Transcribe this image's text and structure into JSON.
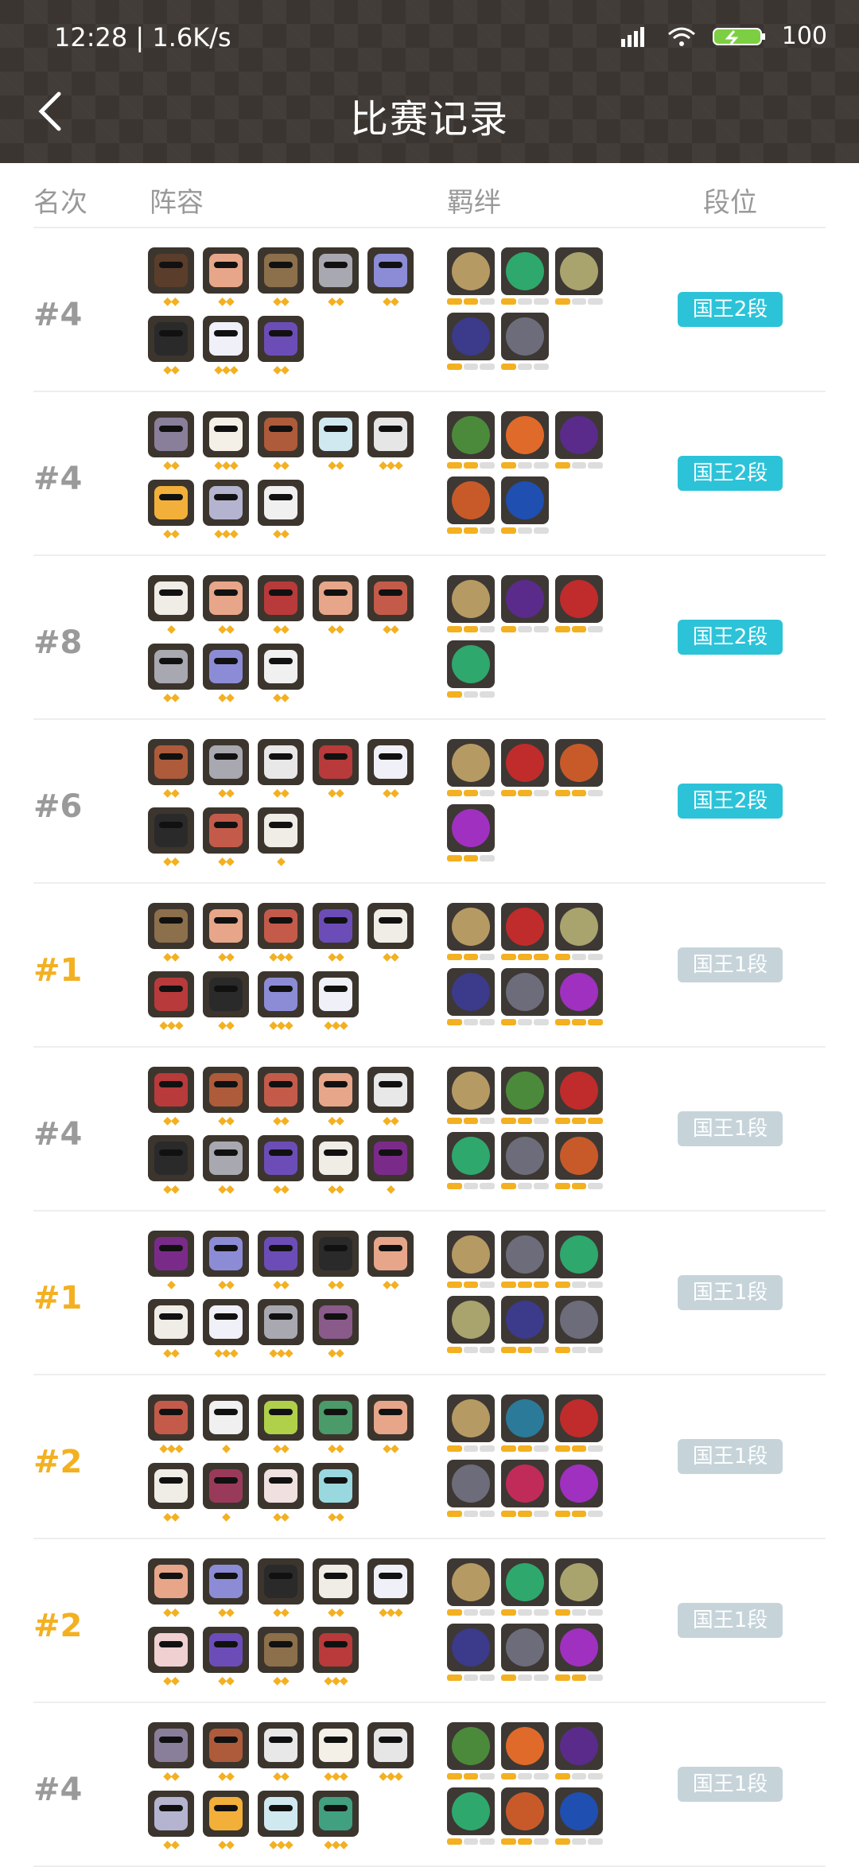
{
  "status": {
    "time": "12:28 | 1.6K/s",
    "battery": "100"
  },
  "title": "比赛记录",
  "columns": {
    "rank": "名次",
    "lineup": "阵容",
    "traits": "羁绊",
    "tier": "段位"
  },
  "rows": [
    {
      "rank": "#4",
      "win": false,
      "tier": "国王2段",
      "tierLevel": "k2",
      "heroes": [
        [
          "#5a3d2a",
          "2"
        ],
        [
          "#e7a68a",
          "2"
        ],
        [
          "#8c6f4b",
          "2"
        ],
        [
          "#a8a8b0",
          "2"
        ],
        [
          "#8c8cd6",
          "2"
        ],
        [
          "#2a2a2a",
          "2"
        ],
        [
          "#f0f0f8",
          "3"
        ],
        [
          "#6c4db8",
          "2"
        ]
      ],
      "traits": [
        [
          "#b69a63",
          "x",
          2
        ],
        [
          "#2ea86c",
          "p",
          1
        ],
        [
          "#a9a36e",
          "c",
          1
        ],
        [
          "#3b3a8b",
          "f",
          1
        ],
        [
          "#6c6c7a",
          "s",
          1
        ]
      ]
    },
    {
      "rank": "#4",
      "win": false,
      "tier": "国王2段",
      "tierLevel": "k2",
      "heroes": [
        [
          "#8a7f9a",
          "2"
        ],
        [
          "#f4f0e8",
          "3"
        ],
        [
          "#ad5b3a",
          "2"
        ],
        [
          "#d0e9f0",
          "2"
        ],
        [
          "#e6e6e6",
          "3"
        ],
        [
          "#f2b03a",
          "2"
        ],
        [
          "#b4b4d0",
          "3"
        ],
        [
          "#f0f0f0",
          "2"
        ]
      ],
      "traits": [
        [
          "#4b8a3a",
          "b",
          2
        ],
        [
          "#e06a2a",
          "l",
          1
        ],
        [
          "#5a2b8a",
          "h",
          1
        ],
        [
          "#c85a2a",
          "d",
          2
        ],
        [
          "#1f4fb0",
          "w",
          1
        ]
      ]
    },
    {
      "rank": "#8",
      "win": false,
      "tier": "国王2段",
      "tierLevel": "k2",
      "heroes": [
        [
          "#f0ece6",
          "1"
        ],
        [
          "#e7a68a",
          "2"
        ],
        [
          "#b83a3a",
          "2"
        ],
        [
          "#e7a68a",
          "2"
        ],
        [
          "#c45b4a",
          "2"
        ],
        [
          "#a8a8b0",
          "2"
        ],
        [
          "#8c8cd6",
          "2"
        ],
        [
          "#f0f0f0",
          "2"
        ]
      ],
      "traits": [
        [
          "#b69a63",
          "x",
          2
        ],
        [
          "#5a2b8a",
          "h",
          1
        ],
        [
          "#c02b2b",
          "a",
          2
        ],
        [
          "#2ea86c",
          "p",
          1
        ]
      ]
    },
    {
      "rank": "#6",
      "win": false,
      "tier": "国王2段",
      "tierLevel": "k2",
      "heroes": [
        [
          "#ad5b3a",
          "2"
        ],
        [
          "#a8a8b0",
          "2"
        ],
        [
          "#e8e8e8",
          "2"
        ],
        [
          "#b83a3a",
          "2"
        ],
        [
          "#f0f0f8",
          "2"
        ],
        [
          "#2a2a2a",
          "2"
        ],
        [
          "#c45b4a",
          "2"
        ],
        [
          "#f0ece6",
          "1"
        ]
      ],
      "traits": [
        [
          "#b69a63",
          "x",
          2
        ],
        [
          "#c02b2b",
          "a",
          2
        ],
        [
          "#c85a2a",
          "d",
          2
        ],
        [
          "#a030c0",
          "m",
          2
        ]
      ]
    },
    {
      "rank": "#1",
      "win": true,
      "tier": "国王1段",
      "tierLevel": "k1",
      "heroes": [
        [
          "#8c6f4b",
          "2"
        ],
        [
          "#e7a68a",
          "2"
        ],
        [
          "#c45b4a",
          "3"
        ],
        [
          "#6c4db8",
          "2"
        ],
        [
          "#f0ece6",
          "2"
        ],
        [
          "#b83a3a",
          "3"
        ],
        [
          "#2a2a2a",
          "2"
        ],
        [
          "#8c8cd6",
          "3"
        ],
        [
          "#f0f0f8",
          "3"
        ]
      ],
      "traits": [
        [
          "#b69a63",
          "x",
          2
        ],
        [
          "#c02b2b",
          "a",
          3
        ],
        [
          "#a9a36e",
          "c",
          1
        ],
        [
          "#3b3a8b",
          "f",
          1
        ],
        [
          "#6c6c7a",
          "s",
          1
        ],
        [
          "#a030c0",
          "m",
          3
        ]
      ]
    },
    {
      "rank": "#4",
      "win": false,
      "tier": "国王1段",
      "tierLevel": "k1",
      "heroes": [
        [
          "#b83a3a",
          "2"
        ],
        [
          "#ad5b3a",
          "2"
        ],
        [
          "#c45b4a",
          "2"
        ],
        [
          "#e7a68a",
          "2"
        ],
        [
          "#e8e8e8",
          "2"
        ],
        [
          "#2a2a2a",
          "2"
        ],
        [
          "#a8a8b0",
          "2"
        ],
        [
          "#6c4db8",
          "2"
        ],
        [
          "#f0ece6",
          "2"
        ],
        [
          "#7a2b8a",
          "1"
        ]
      ],
      "traits": [
        [
          "#b69a63",
          "x",
          2
        ],
        [
          "#4b8a3a",
          "b",
          2
        ],
        [
          "#c02b2b",
          "a",
          3
        ],
        [
          "#2ea86c",
          "p",
          1
        ],
        [
          "#6c6c7a",
          "s",
          1
        ],
        [
          "#c85a2a",
          "d",
          2
        ]
      ]
    },
    {
      "rank": "#1",
      "win": true,
      "tier": "国王1段",
      "tierLevel": "k1",
      "heroes": [
        [
          "#7a2b8a",
          "1"
        ],
        [
          "#8c8cd6",
          "2"
        ],
        [
          "#6c4db8",
          "2"
        ],
        [
          "#2a2a2a",
          "2"
        ],
        [
          "#e7a68a",
          "2"
        ],
        [
          "#f0ece6",
          "2"
        ],
        [
          "#f0f0f8",
          "3"
        ],
        [
          "#a8a8b0",
          "3"
        ],
        [
          "#8a5a8a",
          "2"
        ]
      ],
      "traits": [
        [
          "#b69a63",
          "x",
          2
        ],
        [
          "#6c6c7a",
          "+",
          3
        ],
        [
          "#2ea86c",
          "p",
          1
        ],
        [
          "#a9a36e",
          "c",
          1
        ],
        [
          "#3b3a8b",
          "f",
          2
        ],
        [
          "#6c6c7a",
          "s",
          1
        ]
      ]
    },
    {
      "rank": "#2",
      "win": true,
      "tier": "国王1段",
      "tierLevel": "k1",
      "heroes": [
        [
          "#c45b4a",
          "3"
        ],
        [
          "#f0f0f0",
          "1"
        ],
        [
          "#b0d04a",
          "2"
        ],
        [
          "#4a9a6a",
          "2"
        ],
        [
          "#e7a68a",
          "2"
        ],
        [
          "#f0ece6",
          "2"
        ],
        [
          "#9a3a5a",
          "1"
        ],
        [
          "#f0e0e0",
          "2"
        ],
        [
          "#9ad8e0",
          "2"
        ]
      ],
      "traits": [
        [
          "#b69a63",
          "x",
          1
        ],
        [
          "#2b7a9a",
          "?",
          2
        ],
        [
          "#c02b2b",
          "a",
          2
        ],
        [
          "#6c6c7a",
          "s",
          1
        ],
        [
          "#c02b5a",
          "r",
          2
        ],
        [
          "#a030c0",
          "m",
          2
        ]
      ]
    },
    {
      "rank": "#2",
      "win": true,
      "tier": "国王1段",
      "tierLevel": "k1",
      "heroes": [
        [
          "#e7a68a",
          "2"
        ],
        [
          "#8c8cd6",
          "2"
        ],
        [
          "#2a2a2a",
          "2"
        ],
        [
          "#f0ece6",
          "2"
        ],
        [
          "#f0f0f8",
          "3"
        ],
        [
          "#f0d0d0",
          "2"
        ],
        [
          "#6c4db8",
          "2"
        ],
        [
          "#8c6f4b",
          "2"
        ],
        [
          "#b83a3a",
          "3"
        ]
      ],
      "traits": [
        [
          "#b69a63",
          "x",
          1
        ],
        [
          "#2ea86c",
          "p",
          1
        ],
        [
          "#a9a36e",
          "c",
          1
        ],
        [
          "#3b3a8b",
          "f",
          1
        ],
        [
          "#6c6c7a",
          "s",
          1
        ],
        [
          "#a030c0",
          "m",
          2
        ]
      ]
    },
    {
      "rank": "#4",
      "win": false,
      "tier": "国王1段",
      "tierLevel": "k1",
      "heroes": [
        [
          "#8a7f9a",
          "2"
        ],
        [
          "#ad5b3a",
          "2"
        ],
        [
          "#e8e8e8",
          "2"
        ],
        [
          "#f4f0e8",
          "3"
        ],
        [
          "#e6e6e6",
          "3"
        ],
        [
          "#b4b4d0",
          "2"
        ],
        [
          "#f2b03a",
          "2"
        ],
        [
          "#d0e9f0",
          "3"
        ],
        [
          "#40a080",
          "3"
        ]
      ],
      "traits": [
        [
          "#4b8a3a",
          "b",
          2
        ],
        [
          "#e06a2a",
          "l",
          1
        ],
        [
          "#5a2b8a",
          "h",
          1
        ],
        [
          "#2ea86c",
          "p",
          1
        ],
        [
          "#c85a2a",
          "d",
          2
        ],
        [
          "#1f4fb0",
          "w",
          1
        ]
      ]
    }
  ]
}
